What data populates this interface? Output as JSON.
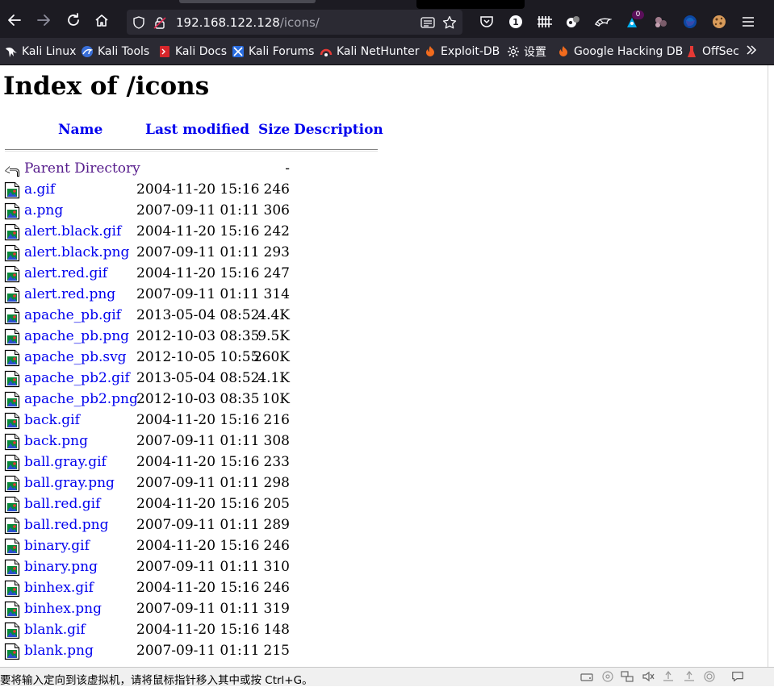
{
  "browser": {
    "url_host": "192.168.122.128",
    "url_path": "/icons/",
    "toolbar_badge": "1",
    "extension_badge": "0"
  },
  "bookmarks": [
    {
      "label": "Kali Linux",
      "icon": "kali-dragon-icon"
    },
    {
      "label": "Kali Tools",
      "icon": "kali-tools-icon"
    },
    {
      "label": "Kali Docs",
      "icon": "kali-docs-icon"
    },
    {
      "label": "Kali Forums",
      "icon": "kali-forums-icon"
    },
    {
      "label": "Kali NetHunter",
      "icon": "nethunter-icon"
    },
    {
      "label": "Exploit-DB",
      "icon": "exploit-db-icon"
    },
    {
      "label": "设置",
      "icon": "gear-icon"
    },
    {
      "label": "Google Hacking DB",
      "icon": "ghdb-icon"
    },
    {
      "label": "OffSec",
      "icon": "offsec-icon"
    }
  ],
  "page": {
    "title": "Index of /icons",
    "headers": {
      "name": "Name",
      "last_modified": "Last modified",
      "size": "Size",
      "description": "Description"
    },
    "parent": {
      "name": "Parent Directory",
      "size": "-"
    },
    "files": [
      {
        "name": "a.gif",
        "modified": "2004-11-20 15:16",
        "size": "246"
      },
      {
        "name": "a.png",
        "modified": "2007-09-11 01:11",
        "size": "306"
      },
      {
        "name": "alert.black.gif",
        "modified": "2004-11-20 15:16",
        "size": "242"
      },
      {
        "name": "alert.black.png",
        "modified": "2007-09-11 01:11",
        "size": "293"
      },
      {
        "name": "alert.red.gif",
        "modified": "2004-11-20 15:16",
        "size": "247"
      },
      {
        "name": "alert.red.png",
        "modified": "2007-09-11 01:11",
        "size": "314"
      },
      {
        "name": "apache_pb.gif",
        "modified": "2013-05-04 08:52",
        "size": "4.4K"
      },
      {
        "name": "apache_pb.png",
        "modified": "2012-10-03 08:35",
        "size": "9.5K"
      },
      {
        "name": "apache_pb.svg",
        "modified": "2012-10-05 10:55",
        "size": "260K"
      },
      {
        "name": "apache_pb2.gif",
        "modified": "2013-05-04 08:52",
        "size": "4.1K"
      },
      {
        "name": "apache_pb2.png",
        "modified": "2012-10-03 08:35",
        "size": "10K"
      },
      {
        "name": "back.gif",
        "modified": "2004-11-20 15:16",
        "size": "216"
      },
      {
        "name": "back.png",
        "modified": "2007-09-11 01:11",
        "size": "308"
      },
      {
        "name": "ball.gray.gif",
        "modified": "2004-11-20 15:16",
        "size": "233"
      },
      {
        "name": "ball.gray.png",
        "modified": "2007-09-11 01:11",
        "size": "298"
      },
      {
        "name": "ball.red.gif",
        "modified": "2004-11-20 15:16",
        "size": "205"
      },
      {
        "name": "ball.red.png",
        "modified": "2007-09-11 01:11",
        "size": "289"
      },
      {
        "name": "binary.gif",
        "modified": "2004-11-20 15:16",
        "size": "246"
      },
      {
        "name": "binary.png",
        "modified": "2007-09-11 01:11",
        "size": "310"
      },
      {
        "name": "binhex.gif",
        "modified": "2004-11-20 15:16",
        "size": "246"
      },
      {
        "name": "binhex.png",
        "modified": "2007-09-11 01:11",
        "size": "319"
      },
      {
        "name": "blank.gif",
        "modified": "2004-11-20 15:16",
        "size": "148"
      },
      {
        "name": "blank.png",
        "modified": "2007-09-11 01:11",
        "size": "215"
      }
    ]
  },
  "statusbar": {
    "text": "要将输入定向到该虚拟机，请将鼠标指针移入其中或按 Ctrl+G。"
  },
  "colors": {
    "chrome_dark": "#1c1b22",
    "urlbar": "#2b2a33",
    "link": "#0000ee",
    "visited": "#551a8b"
  }
}
